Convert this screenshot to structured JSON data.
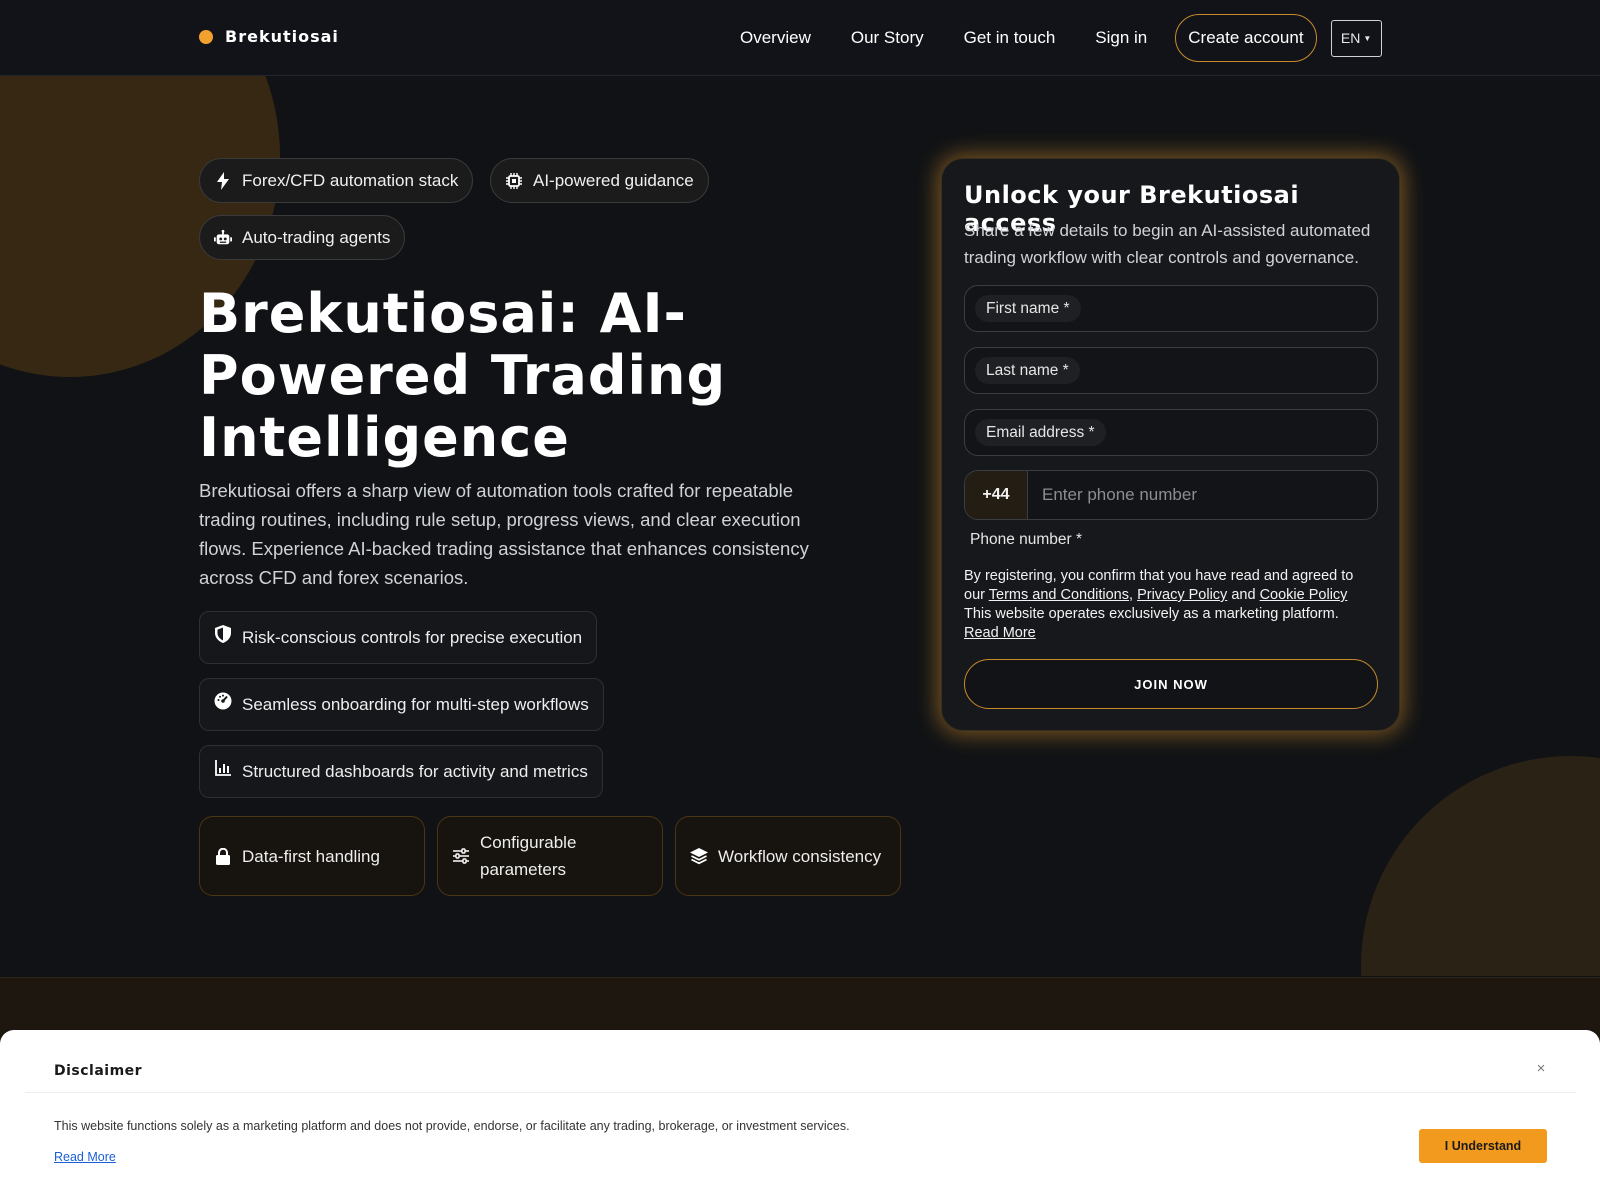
{
  "header": {
    "brand": "Brekutiosai",
    "nav": [
      "Overview",
      "Our Story",
      "Get in touch",
      "Sign in"
    ],
    "cta": "Create account",
    "language": "EN"
  },
  "hero": {
    "tags": [
      "Forex/CFD automation stack",
      "AI-powered guidance",
      "Auto-trading agents"
    ],
    "headline": "Brekutiosai: AI-Powered Trading Intelligence",
    "lead": "Brekutiosai offers a sharp view of automation tools crafted for repeatable trading routines, including rule setup, progress views, and clear execution flows. Experience AI-backed trading assistance that enhances consistency across CFD and forex scenarios.",
    "features": [
      "Risk-conscious controls for precise execution",
      "Seamless onboarding for multi-step workflows",
      "Structured dashboards for activity and metrics"
    ],
    "cards": [
      "Data-first handling",
      "Configurable parameters",
      "Workflow consistency"
    ]
  },
  "form": {
    "title": "Unlock your Brekutiosai access",
    "subtitle": "Share a few details to begin an AI-assisted automated trading workflow with clear controls and governance.",
    "first_name": "First name *",
    "last_name": "Last name *",
    "email": "Email address *",
    "phone_code": "+44",
    "phone_placeholder": "Enter phone number",
    "phone_label": "Phone number *",
    "legal_prefix": "By registering, you confirm that you have read and agreed to our",
    "terms": "Terms and Conditions",
    "privacy": "Privacy Policy",
    "and": "and",
    "cookie": "Cookie Policy",
    "marketing_note": "This website operates exclusively as a marketing platform.",
    "read_more": "Read More",
    "submit": "JOIN NOW"
  },
  "disclaimer": {
    "title": "Disclaimer",
    "text": "This website functions solely as a marketing platform and does not provide, endorse, or facilitate any trading, brokerage, or investment services.",
    "read_more": "Read More",
    "button": "I Understand",
    "close": "×"
  },
  "colors": {
    "accent": "#f2a12e",
    "background": "#101215",
    "button_disclaimer": "#f29a1e"
  }
}
